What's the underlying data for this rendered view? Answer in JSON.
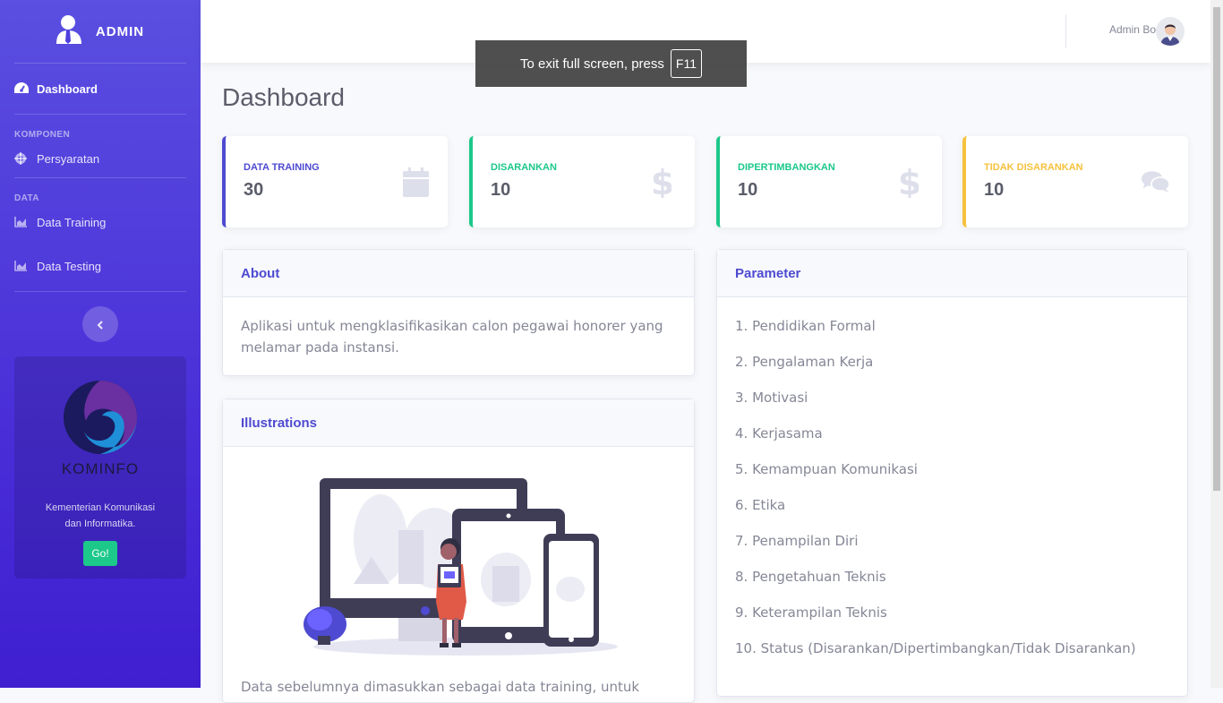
{
  "sidebar": {
    "brand": "ADMIN",
    "items": {
      "dashboard": "Dashboard",
      "persyaratan": "Persyaratan",
      "data_training": "Data Training",
      "data_testing": "Data Testing"
    },
    "headings": {
      "komponen": "KOMPONEN",
      "data": "DATA"
    },
    "promo": {
      "logo_text": "KOMINFO",
      "text_line1": "Kementerian Komunikasi",
      "text_line2": "dan Informatika.",
      "button": "Go!"
    }
  },
  "topbar": {
    "user_name": "Admin Boz"
  },
  "toast": {
    "text": "To exit full screen, press",
    "key": "F11"
  },
  "page_title": "Dashboard",
  "stats": [
    {
      "label": "DATA TRAINING",
      "value": "30",
      "color": "#4e4ad1",
      "icon": "calendar-icon"
    },
    {
      "label": "DISARANKAN",
      "value": "10",
      "color": "#1cc88a",
      "icon": "dollar-icon"
    },
    {
      "label": "DIPERTIMBANGKAN",
      "value": "10",
      "color": "#1cc88a",
      "icon": "dollar-icon"
    },
    {
      "label": "TIDAK DISARANKAN",
      "value": "10",
      "color": "#f6c23e",
      "icon": "comments-icon"
    }
  ],
  "about": {
    "title": "About",
    "text_line1": "Aplikasi untuk mengklasifikasikan calon pegawai honorer yang",
    "text_line2": "melamar pada instansi."
  },
  "illustrations": {
    "title": "Illustrations",
    "caption": "Data sebelumnya dimasukkan sebagai data training, untuk"
  },
  "parameter": {
    "title": "Parameter",
    "items": [
      "1. Pendidikan Formal",
      "2. Pengalaman Kerja",
      "3. Motivasi",
      "4. Kerjasama",
      "5. Kemampuan Komunikasi",
      "6. Etika",
      "7. Penampilan Diri",
      "8. Pengetahuan Teknis",
      "9. Keterampilan Teknis",
      "10. Status (Disarankan/Dipertimbangkan/Tidak Disarankan)"
    ]
  }
}
